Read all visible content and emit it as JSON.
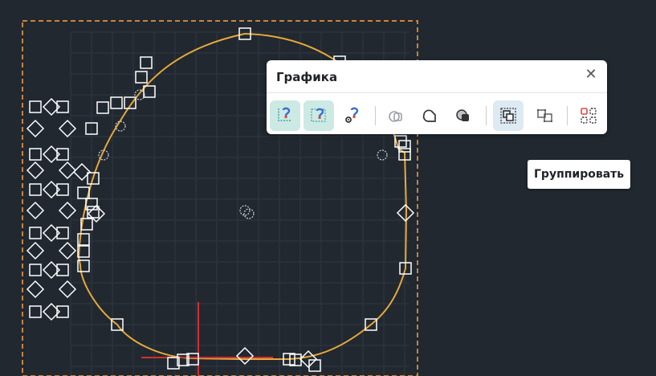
{
  "palette": {
    "title": "Графика",
    "close_glyph": "✕",
    "tools": [
      {
        "icon": "snap-magnet-grid-icon",
        "state": "active"
      },
      {
        "icon": "snap-magnet-area-icon",
        "state": "active"
      },
      {
        "icon": "magnet-settings-icon",
        "state": "normal"
      },
      {
        "icon": "shape-union-outline-icon",
        "state": "disabled"
      },
      {
        "icon": "shape-subtract-icon",
        "state": "normal"
      },
      {
        "icon": "shape-intersect-icon",
        "state": "normal"
      },
      {
        "icon": "group-icon",
        "state": "hover"
      },
      {
        "icon": "ungroup-icon",
        "state": "normal"
      },
      {
        "icon": "select-all-nodes-icon",
        "state": "normal"
      }
    ]
  },
  "tooltip": {
    "text": "Группировать"
  },
  "colors": {
    "background": "#212830",
    "grid": "#2e3744",
    "shape_outline": "#e8a93a",
    "frame_dashed": "#c8833a",
    "axis_red": "#d23030",
    "handle": "#ffffff",
    "active_tool": "#cde9e4",
    "icon_teal": "#3aa7a0",
    "icon_red": "#e04545",
    "icon_blue": "#3a6fd0"
  }
}
